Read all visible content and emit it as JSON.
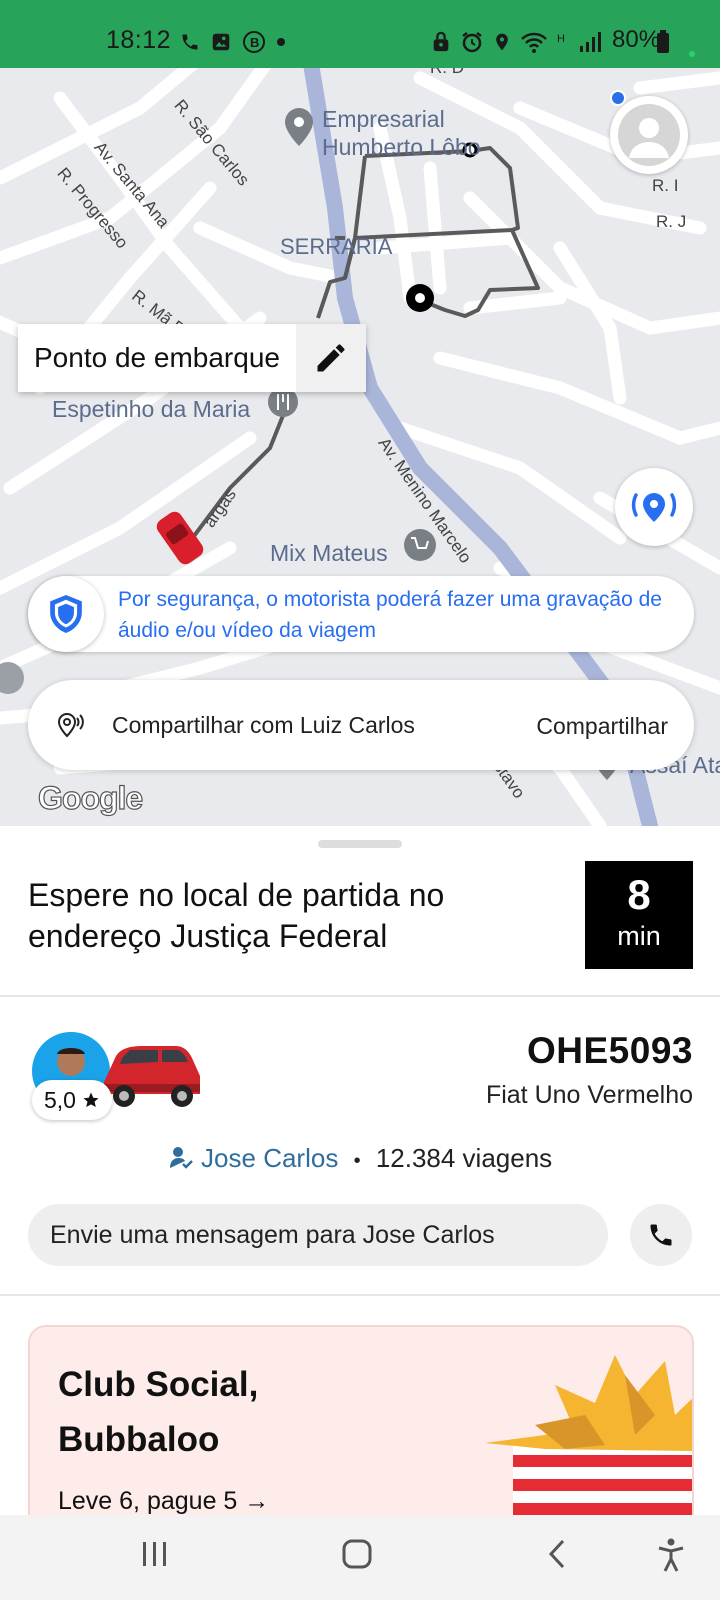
{
  "status_bar": {
    "time": "18:12",
    "battery": "80%",
    "accent": "#27a35a"
  },
  "map": {
    "pickup_chip_label": "Ponto de embarque",
    "labels": {
      "empresarial_line1": "Empresarial",
      "empresarial_line2": "Humberto Lôbo",
      "serraria": "SERRARIA",
      "espetinho": "Espetinho da Maria",
      "mix_mateus": "Mix Mateus",
      "assai": "Assaí Ata",
      "av_sao_carlos": "R. São Carlos",
      "av_santa_ana": "Av. Santa Ana",
      "r_progresso": "R. Progresso",
      "r_mae": "R. Mã R. E",
      "av_menino_marcelo": "Av. Menino Marcelo",
      "vargas": "argas",
      "r_i": "R. I",
      "r_j": "R. J",
      "gustavo": "ustavo",
      "rd": "R. D",
      "google": "Google"
    },
    "safety_banner": "Por segurança, o motorista poderá fazer uma gravação de áudio e/ou vídeo da viagem",
    "share_text": "Compartilhar com Luiz Carlos",
    "share_action": "Compartilhar"
  },
  "trip": {
    "wait_message": "Espere no local de partida no endereço Justiça Federal",
    "eta_value": "8",
    "eta_unit": "min"
  },
  "driver": {
    "rating": "5,0",
    "plate": "OHE5093",
    "car_model": "Fiat Uno Vermelho",
    "name": "Jose Carlos",
    "trips": "12.384 viagens",
    "message_placeholder": "Envie uma mensagem para Jose Carlos"
  },
  "promo": {
    "title_line1": "Club Social,",
    "title_line2": "Bubbaloo",
    "subtitle": "Leve 6, pague 5 →"
  },
  "icons": [
    "phone-icon",
    "image-icon",
    "b-icon",
    "alarm-icon",
    "location-icon",
    "wifi-icon",
    "signal-icon",
    "battery-icon",
    "edit-icon",
    "locate-icon",
    "shield-icon",
    "share-pin-icon",
    "star-icon",
    "driver-check-icon",
    "call-icon",
    "recents-icon",
    "home-icon",
    "back-icon",
    "accessibility-icon"
  ]
}
